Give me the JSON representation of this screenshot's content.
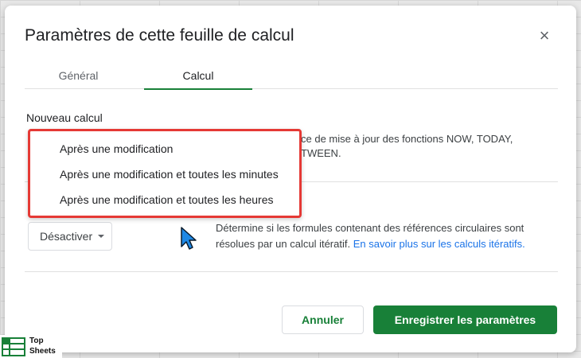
{
  "dialog": {
    "title": "Paramètres de cette feuille de calcul",
    "close_icon": "close-icon"
  },
  "tabs": [
    {
      "label": "Général",
      "active": false
    },
    {
      "label": "Calcul",
      "active": true
    }
  ],
  "recalc": {
    "label": "Nouveau calcul",
    "description_visible": "ce de mise à jour des fonctions NOW, TODAY,\nTWEEN.",
    "options": [
      "Après une modification",
      "Après une modification et toutes les minutes",
      "Après une modification et toutes les heures"
    ]
  },
  "iterative": {
    "select_value": "Désactiver",
    "description": "Détermine si les formules contenant des références circulaires sont résolues par un calcul itératif.",
    "link": "En savoir plus sur les calculs itératifs."
  },
  "footer": {
    "cancel_label": "Annuler",
    "save_label": "Enregistrer les paramètres"
  },
  "watermark": {
    "line1": "Top",
    "line2": "Sheets"
  },
  "colors": {
    "accent_green": "#188038",
    "link_blue": "#1a73e8",
    "highlight_red": "#e53935",
    "cursor_blue": "#1e88e5"
  }
}
